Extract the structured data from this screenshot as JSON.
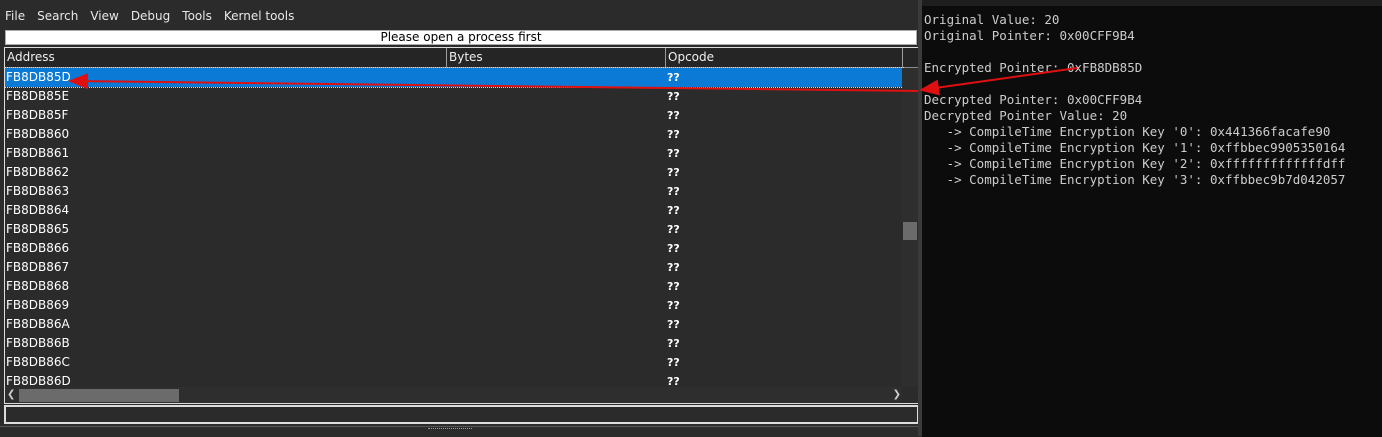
{
  "menu": [
    "File",
    "Search",
    "View",
    "Debug",
    "Tools",
    "Kernel tools"
  ],
  "status_top": "Please open a process first",
  "columns": {
    "address": "Address",
    "bytes": "Bytes",
    "opcode": "Opcode"
  },
  "rows": [
    {
      "address": "FB8DB85D",
      "opcode": "??",
      "selected": true
    },
    {
      "address": "FB8DB85E",
      "opcode": "??"
    },
    {
      "address": "FB8DB85F",
      "opcode": "??"
    },
    {
      "address": "FB8DB860",
      "opcode": "??"
    },
    {
      "address": "FB8DB861",
      "opcode": "??"
    },
    {
      "address": "FB8DB862",
      "opcode": "??"
    },
    {
      "address": "FB8DB863",
      "opcode": "??"
    },
    {
      "address": "FB8DB864",
      "opcode": "??"
    },
    {
      "address": "FB8DB865",
      "opcode": "??"
    },
    {
      "address": "FB8DB866",
      "opcode": "??"
    },
    {
      "address": "FB8DB867",
      "opcode": "??"
    },
    {
      "address": "FB8DB868",
      "opcode": "??"
    },
    {
      "address": "FB8DB869",
      "opcode": "??"
    },
    {
      "address": "FB8DB86A",
      "opcode": "??"
    },
    {
      "address": "FB8DB86B",
      "opcode": "??"
    },
    {
      "address": "FB8DB86C",
      "opcode": "??"
    },
    {
      "address": "FB8DB86D",
      "opcode": "??"
    }
  ],
  "console": {
    "original_value": "Original Value: 20",
    "original_pointer": "Original Pointer: 0x00CFF9B4",
    "encrypted_pointer": "Encrypted Pointer: 0xFB8DB85D",
    "decrypted_pointer": "Decrypted Pointer: 0x00CFF9B4",
    "decrypted_value": "Decrypted Pointer Value: 20",
    "keys": [
      "   -> CompileTime Encryption Key '0': 0x441366facafe90",
      "   -> CompileTime Encryption Key '1': 0xffbbec9905350164",
      "   -> CompileTime Encryption Key '2': 0xfffffffffffffdff",
      "   -> CompileTime Encryption Key '3': 0xffbbec9b7d042057"
    ]
  },
  "colors": {
    "selection": "#0a7ad6",
    "annotation_arrow": "#e01010",
    "console_bg": "#0c0c0c"
  }
}
